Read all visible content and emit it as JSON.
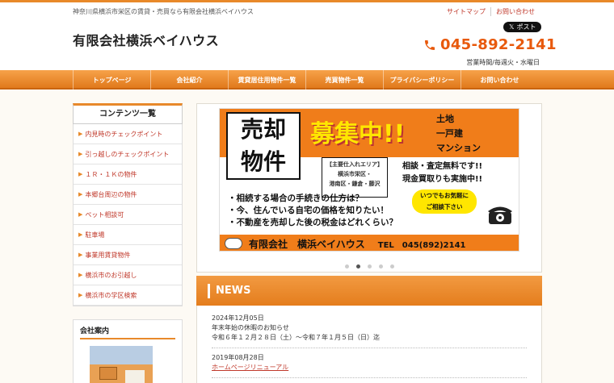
{
  "header": {
    "tagline": "神奈川県横浜市栄区の賃貸・売買なら有限会社横浜ベイハウス",
    "site_title": "有限会社横浜ベイハウス",
    "links": [
      "サイトマップ",
      "お問い合わせ"
    ],
    "x_post_label": "ポスト",
    "phone": "045-892-2141",
    "hours": "営業時間/毎週火・水曜日"
  },
  "nav": {
    "items": [
      "トップページ",
      "会社紹介",
      "賃貸居住用物件一覧",
      "売買物件一覧",
      "プライバシーポリシー",
      "お問い合わせ"
    ]
  },
  "sidebar": {
    "title": "コンテンツ一覧",
    "items": [
      "内見時のチェックポイント",
      "引っ越しのチェックポイント",
      "１Ｒ・１Ｋの物件",
      "本郷台周辺の物件",
      "ペット相談可",
      "駐車場",
      "事業用賃貸物件",
      "横浜市のお引越し",
      "横浜市の学区検索"
    ],
    "company_title": "会社案内"
  },
  "banner": {
    "sell_l1": "売却",
    "sell_l2": "物件",
    "boshu": "募集中!!",
    "types": [
      "土地",
      "一戸建",
      "マンション"
    ],
    "area_l1": "【主要仕入れエリア】",
    "area_l2": "横浜市栄区・",
    "area_l3": "港南区・鎌倉・藤沢",
    "free_l1": "相談・査定無料です!!",
    "free_l2": "現金買取りも実施中!!",
    "questions": [
      "・相続する場合の手続きの仕方は？",
      "・今、住んでいる自宅の価格を知りたい！",
      "・不動産を売却した後の税金はどれくらい？"
    ],
    "cta_l1": "いつでもお気軽に",
    "cta_l2": "ご相談下さい",
    "company": "有限会社　横浜ベイハウス",
    "tel": "TEL　045(892)2141"
  },
  "news": {
    "heading": "NEWS",
    "items": [
      {
        "date": "2024年12月05日",
        "title": "年末年始の休暇のお知らせ",
        "text": "令和６年１２月２８日（土）〜令和７年１月５日（日）迄"
      },
      {
        "date": "2019年08月28日",
        "link": "ホームページリニューアル"
      }
    ]
  },
  "colors": {
    "accent": "#e8892a",
    "link": "#c0392b",
    "phone": "#e8590c"
  }
}
